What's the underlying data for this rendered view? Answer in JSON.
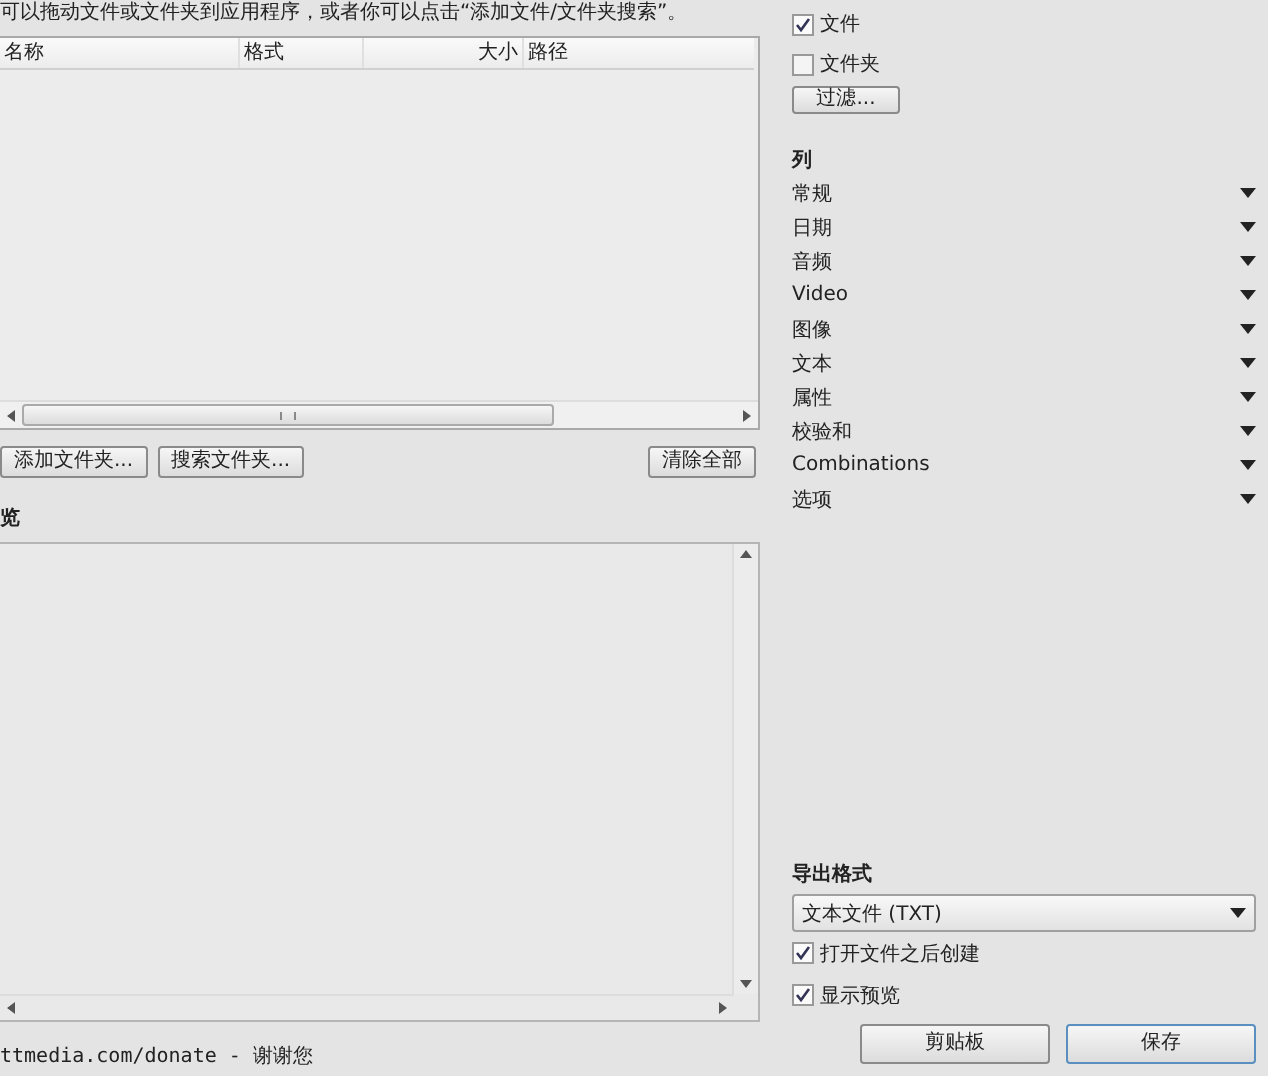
{
  "intro": "可以拖动文件或文件夹到应用程序，或者你可以点击“添加文件/文件夹搜索”。",
  "table": {
    "columns": [
      "名称",
      "格式",
      "大小",
      "路径"
    ]
  },
  "left_buttons": [
    "添加文件夹...",
    "搜索文件夹..."
  ],
  "clear_button": "清除全部",
  "preview": {
    "label": "览"
  },
  "footer": "ttmedia.com/donate - 谢谢您",
  "filters": [
    {
      "label": "文件",
      "checked": true
    },
    {
      "label": "文件夹",
      "checked": false
    }
  ],
  "filter_button": "过滤...",
  "columns_panel": {
    "title": "列",
    "items": [
      "常规",
      "日期",
      "音频",
      "Video",
      "图像",
      "文本",
      "属性",
      "校验和",
      "Combinations",
      "选项"
    ]
  },
  "export": {
    "title": "导出格式",
    "format": "文本文件 (TXT)",
    "options": [
      {
        "label": "打开文件之后创建",
        "checked": true
      },
      {
        "label": "显示预览",
        "checked": true
      }
    ]
  },
  "actions": [
    "剪贴板",
    "保存"
  ]
}
